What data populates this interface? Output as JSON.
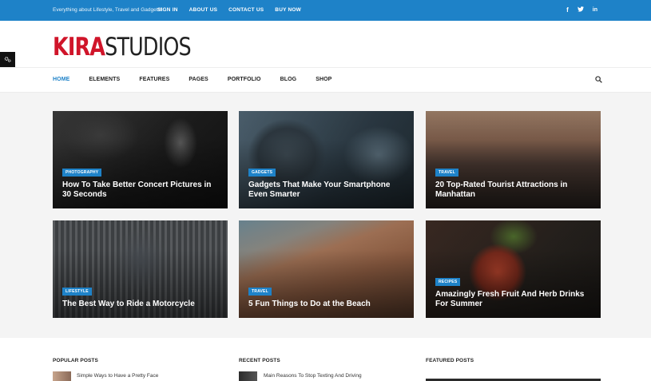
{
  "topbar": {
    "tagline": "Everything about Lifestyle, Travel and Gadgets!",
    "links": [
      "SIGN IN",
      "ABOUT US",
      "CONTACT US",
      "BUY NOW"
    ],
    "social": [
      {
        "icon": "facebook-icon",
        "glyph": "f"
      },
      {
        "icon": "twitter-icon",
        "glyph": "𝕥"
      },
      {
        "icon": "linkedin-icon",
        "glyph": "in"
      }
    ],
    "color": "#1e82c8"
  },
  "logo": {
    "part1": "KIRA",
    "part2": "STUDIOS",
    "accent": "#d0152a"
  },
  "nav": {
    "items": [
      "HOME",
      "ELEMENTS",
      "FEATURES",
      "PAGES",
      "PORTFOLIO",
      "BLOG",
      "SHOP"
    ],
    "active": "HOME"
  },
  "cards": [
    {
      "category": "PHOTOGRAPHY",
      "title": "How To Take Better Concert Pictures in 30 Seconds"
    },
    {
      "category": "GADGETS",
      "title": "Gadgets That Make Your Smartphone Even Smarter"
    },
    {
      "category": "TRAVEL",
      "title": "20 Top-Rated Tourist Attractions in Manhattan"
    },
    {
      "category": "LIFESTYLE",
      "title": "The Best Way to Ride a Motorcycle"
    },
    {
      "category": "TRAVEL",
      "title": "5 Fun Things to Do at the Beach"
    },
    {
      "category": "RECIPES",
      "title": "Amazingly Fresh Fruit And Herb Drinks For Summer"
    }
  ],
  "widgets": {
    "popular": {
      "title": "POPULAR POSTS",
      "first": "Simple Ways to Have a Pretty Face"
    },
    "recent": {
      "title": "RECENT POSTS",
      "first": "Main Reasons To Stop Texting And Driving"
    },
    "featured": {
      "title": "FEATURED POSTS"
    }
  }
}
